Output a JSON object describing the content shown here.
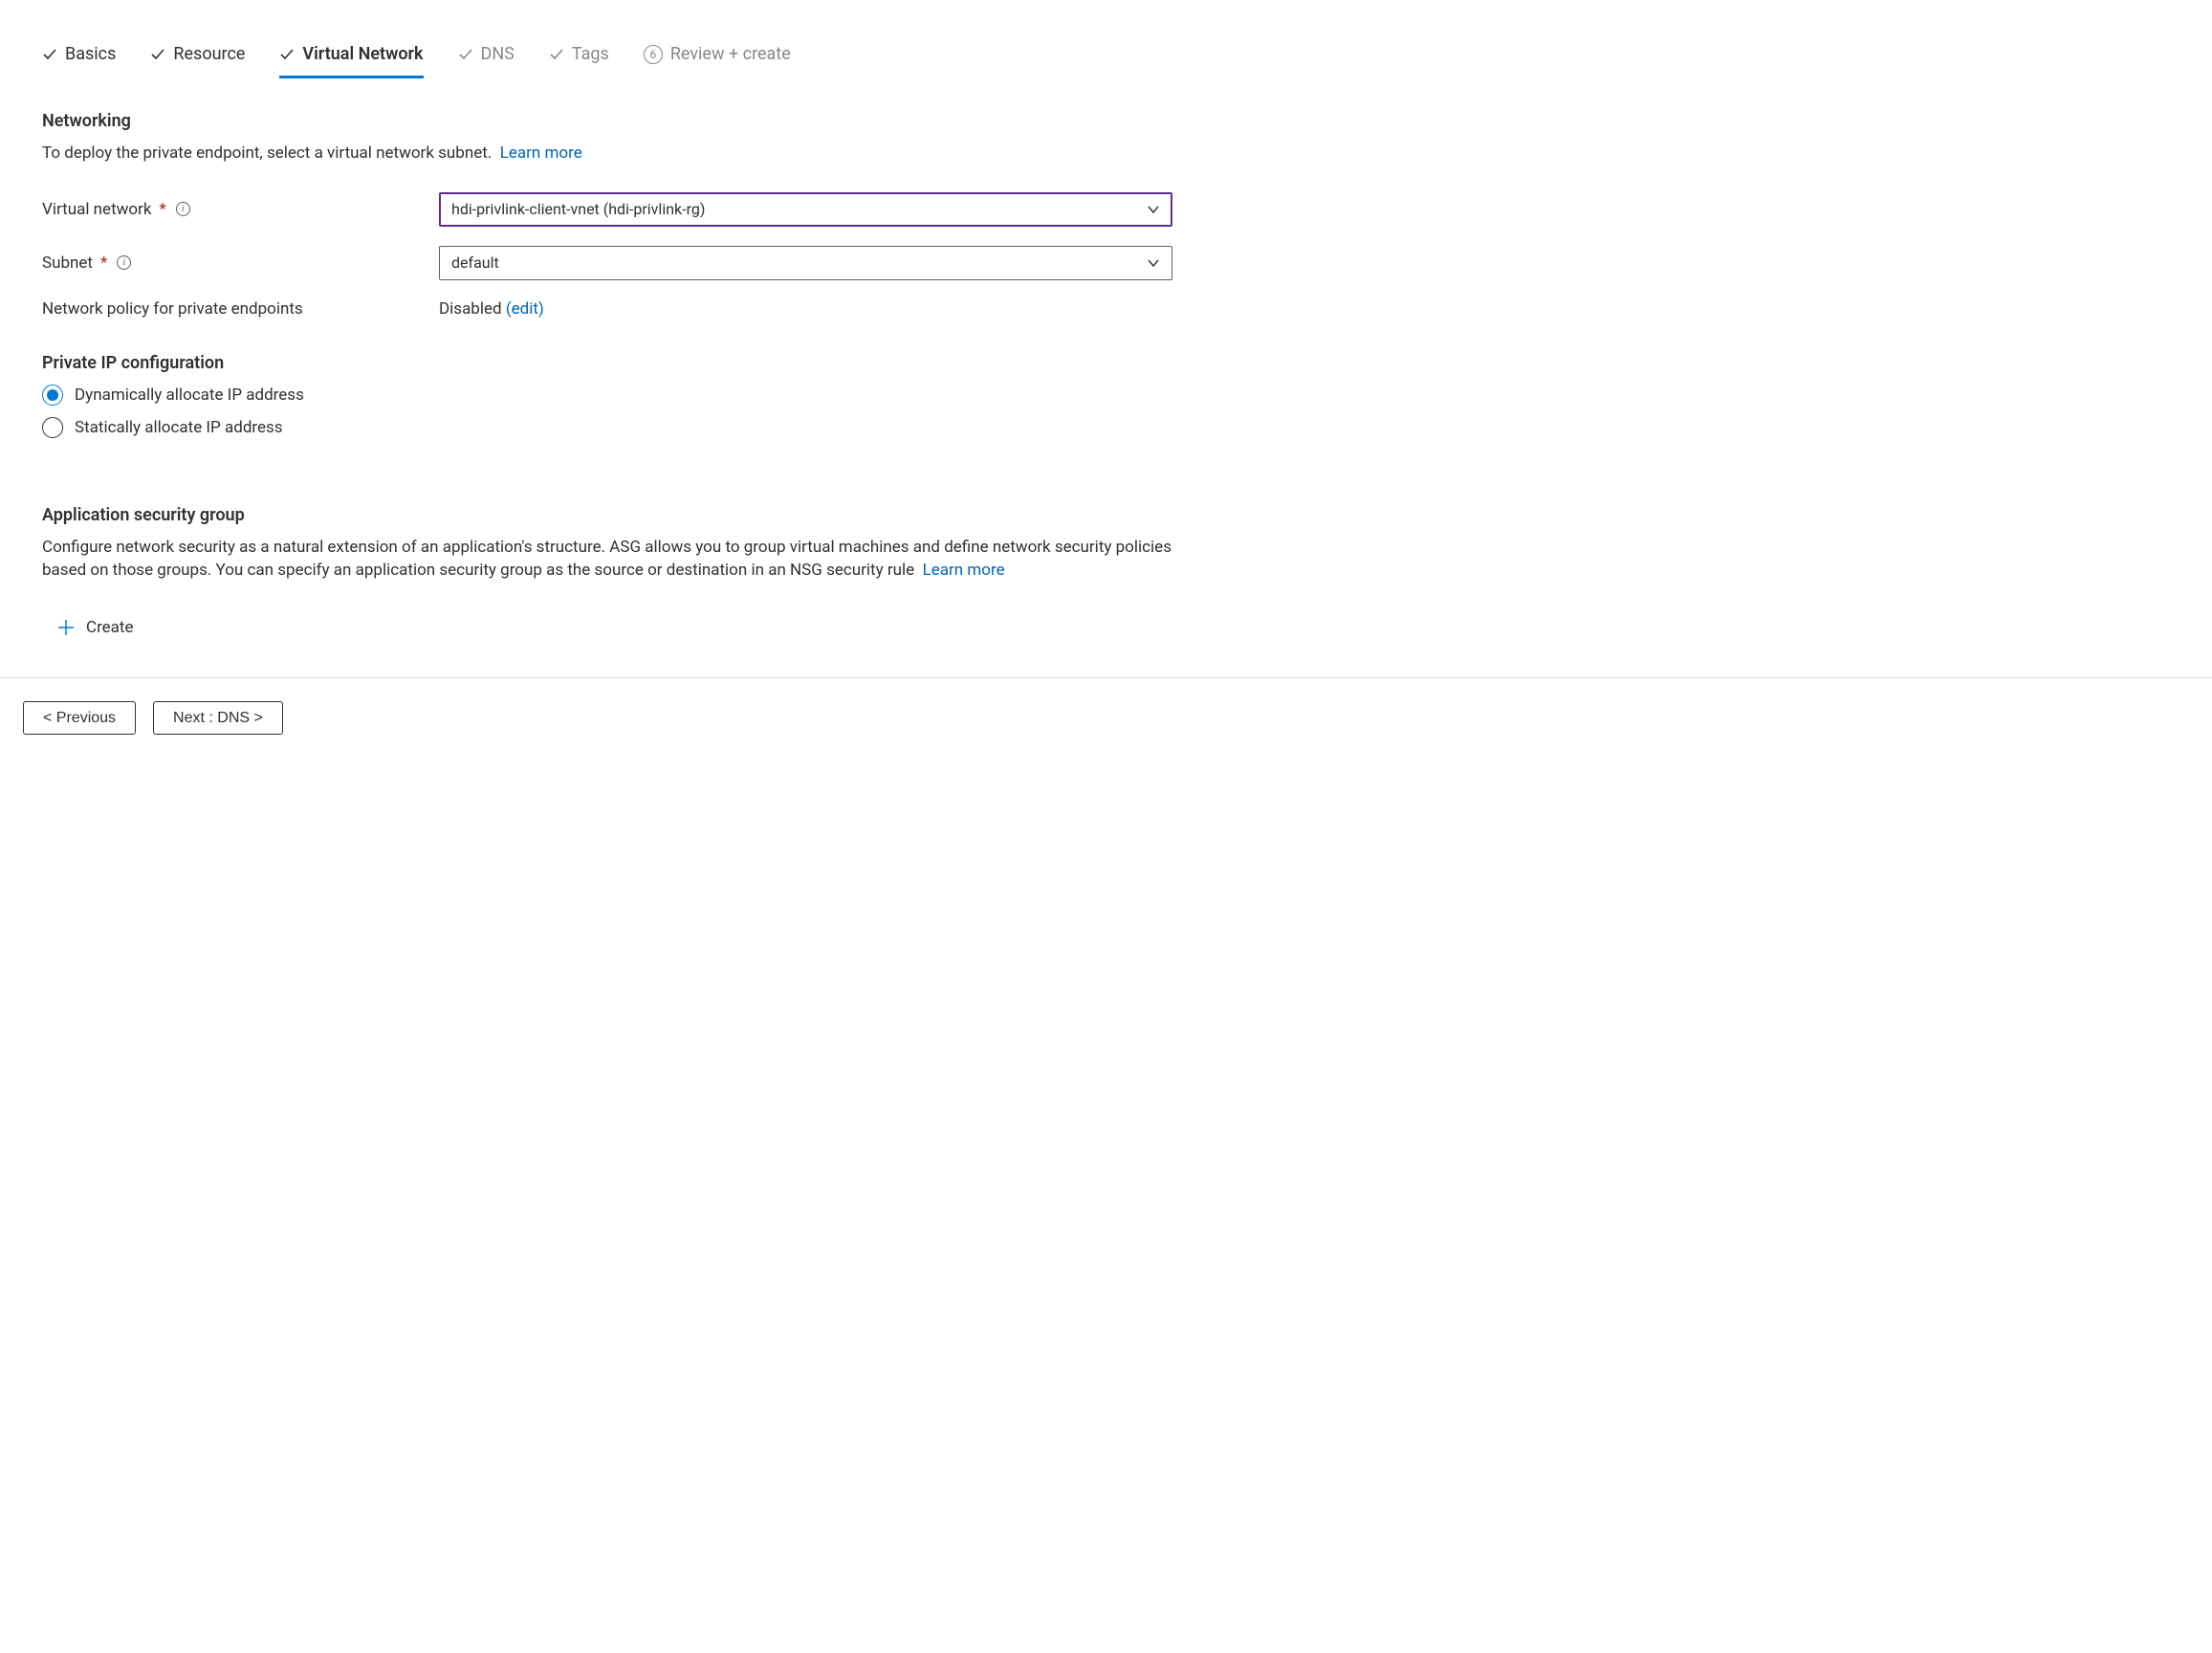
{
  "tabs": {
    "basics": "Basics",
    "resource": "Resource",
    "virtual_network": "Virtual Network",
    "dns": "DNS",
    "tags": "Tags",
    "review": "Review + create",
    "review_step": "6"
  },
  "networking": {
    "title": "Networking",
    "desc": "To deploy the private endpoint, select a virtual network subnet.",
    "learn_more": "Learn more",
    "vnet_label": "Virtual network",
    "vnet_value": "hdi-privlink-client-vnet (hdi-privlink-rg)",
    "subnet_label": "Subnet",
    "subnet_value": "default",
    "policy_label": "Network policy for private endpoints",
    "policy_value": "Disabled",
    "policy_edit": "(edit)"
  },
  "ipconfig": {
    "title": "Private IP configuration",
    "dynamic": "Dynamically allocate IP address",
    "static": "Statically allocate IP address"
  },
  "asg": {
    "title": "Application security group",
    "desc": "Configure network security as a natural extension of an application's structure. ASG allows you to group virtual machines and define network security policies based on those groups. You can specify an application security group as the source or destination in an NSG security rule",
    "learn_more": "Learn more",
    "create": "Create"
  },
  "footer": {
    "previous": "< Previous",
    "next": "Next : DNS >"
  }
}
